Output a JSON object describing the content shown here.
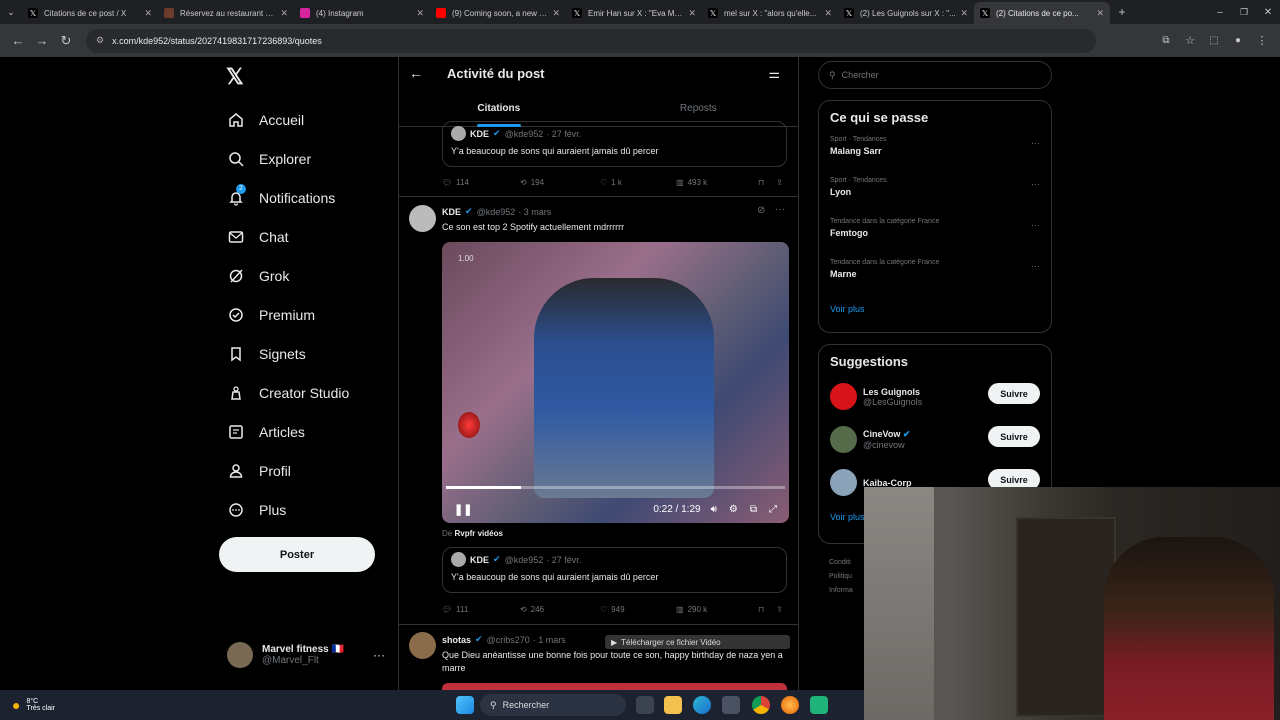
{
  "browser": {
    "tabs": [
      {
        "title": "Citations de ce post / X",
        "icon": "x-icon",
        "active": false
      },
      {
        "title": "Réservez au restaurant Le...",
        "icon": "restaurant-icon",
        "active": false
      },
      {
        "title": "(4) Instagram",
        "icon": "instagram-icon",
        "active": false
      },
      {
        "title": "(9) Coming soon, a new R...",
        "icon": "youtube-icon",
        "active": false
      },
      {
        "title": "Emir Han sur X : \"Eva Men...",
        "icon": "x-icon",
        "active": false
      },
      {
        "title": "mel sur X : \"alors qu'elle...",
        "icon": "x-icon",
        "active": false
      },
      {
        "title": "(2) Les Guignols sur X : \"...",
        "icon": "x-icon",
        "active": false
      },
      {
        "title": "(2) Citations de ce po...",
        "icon": "x-icon",
        "active": true
      }
    ],
    "url": "x.com/kde952/status/2027419831717236893/quotes"
  },
  "sidebar": {
    "logo": "𝕏",
    "items": [
      {
        "label": "Accueil",
        "icon": "home-icon"
      },
      {
        "label": "Explorer",
        "icon": "search-icon"
      },
      {
        "label": "Notifications",
        "icon": "bell-icon",
        "badge": "2"
      },
      {
        "label": "Chat",
        "icon": "mail-icon"
      },
      {
        "label": "Grok",
        "icon": "grok-icon"
      },
      {
        "label": "Premium",
        "icon": "premium-icon"
      },
      {
        "label": "Signets",
        "icon": "bookmark-icon"
      },
      {
        "label": "Creator Studio",
        "icon": "creator-icon"
      },
      {
        "label": "Articles",
        "icon": "articles-icon"
      },
      {
        "label": "Profil",
        "icon": "profile-icon"
      },
      {
        "label": "Plus",
        "icon": "more-icon"
      }
    ],
    "post_label": "Poster",
    "profile": {
      "name": "Marvel fitness 🇫🇷",
      "handle": "@Marvel_Flt"
    }
  },
  "main": {
    "title": "Activité du post",
    "tabs": [
      "Citations",
      "Reposts"
    ],
    "quote_top": {
      "name": "KDE",
      "handle": "@kde952",
      "date": "· 27 févr.",
      "text": "Y'a beaucoup de sons qui auraient jamais dû percer",
      "stats": {
        "replies": "114",
        "reposts": "194",
        "likes": "1 k",
        "views": "493 k"
      }
    },
    "tweet": {
      "name": "KDE",
      "handle": "@kde952",
      "date": "· 3 mars",
      "text": "Ce son est top 2 Spotify actuellement mdrrrrrr",
      "video": {
        "speed": "1.00",
        "time": "0:22 / 1:29",
        "progress": 0.22
      },
      "source_prefix": "De",
      "source": "Rvpfr vidéos",
      "quoted": {
        "name": "KDE",
        "handle": "@kde952",
        "date": "· 27 févr.",
        "text": "Y'a beaucoup de sons qui auraient jamais dû percer"
      },
      "stats": {
        "replies": "111",
        "reposts": "246",
        "likes": "949",
        "views": "290 k"
      }
    },
    "next": {
      "name": "shotas",
      "handle": "@cribs270",
      "date": "· 1 mars",
      "text": "Que Dieu anéantisse une bonne fois pour toute ce son, happy birthday de naza yen a marre"
    }
  },
  "overlay": {
    "label": "Télécharger ce fichier Vidéo"
  },
  "right": {
    "search_placeholder": "Chercher",
    "trends_title": "Ce qui se passe",
    "trends": [
      {
        "meta": "Sport · Tendances",
        "name": "Malang Sarr"
      },
      {
        "meta": "Sport · Tendances",
        "name": "Lyon"
      },
      {
        "meta": "Tendance dans la catégorie France",
        "name": "Femtogo"
      },
      {
        "meta": "Tendance dans la catégorie France",
        "name": "Marne"
      }
    ],
    "see_more": "Voir plus",
    "suggestions_title": "Suggestions",
    "suggestions": [
      {
        "name": "Les Guignols",
        "handle": "@LesGuignols",
        "color": "#d7141a"
      },
      {
        "name": "CineVow",
        "handle": "@cinevow",
        "color": "#556b4a"
      },
      {
        "name": "Kaiba-Corp",
        "handle": "",
        "color": "#8aa3b8"
      }
    ],
    "follow_label": "Suivre",
    "see_more_2": "Voir plus",
    "footer": [
      "Conditi",
      "Politiqu",
      "Informa"
    ]
  },
  "taskbar": {
    "temp": "8°C",
    "weather": "Très clair",
    "search": "Rechercher"
  },
  "colors": {
    "accent": "#1d9bf0",
    "background": "#000000",
    "border": "#2f3336"
  }
}
